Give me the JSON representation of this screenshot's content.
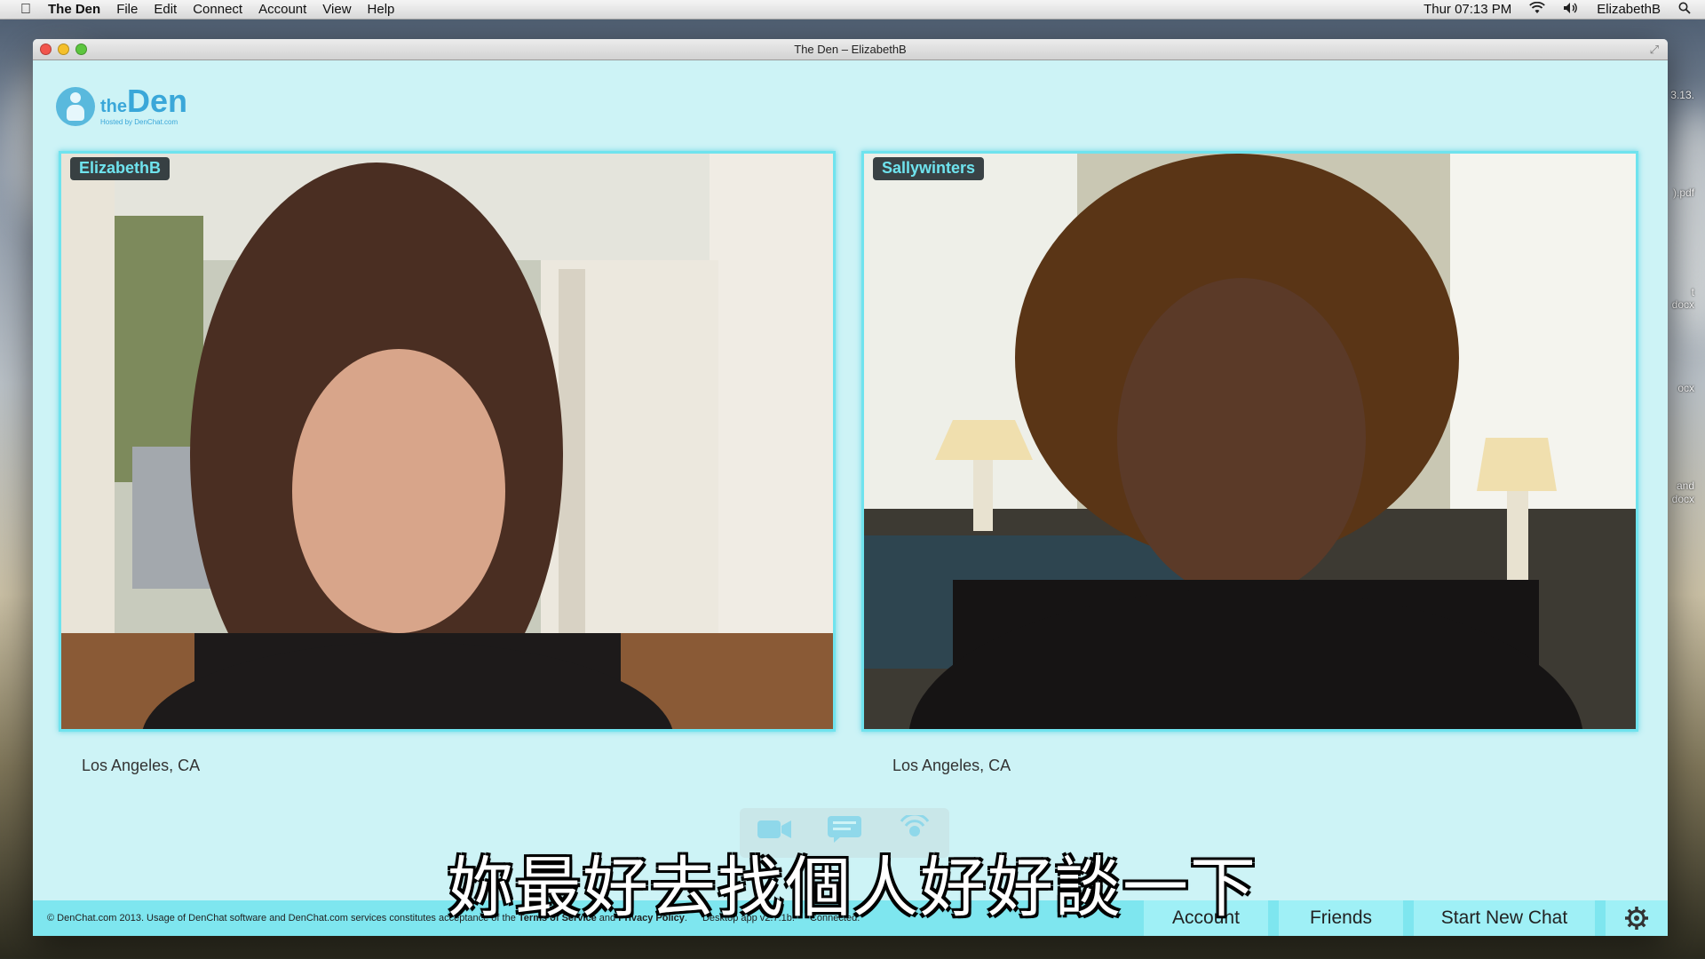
{
  "menubar": {
    "app_name": "The Den",
    "menus": [
      "File",
      "Edit",
      "Connect",
      "Account",
      "View",
      "Help"
    ],
    "clock": "Thur 07:13 PM",
    "user": "ElizabethB"
  },
  "desktop": {
    "edge_labels": [
      "3.13.",
      ").pdf",
      "t",
      "docx",
      "ocx",
      "and",
      "docx"
    ]
  },
  "window": {
    "title": "The Den – ElizabethB"
  },
  "logo": {
    "the": "the",
    "den": "Den",
    "tagline": "Hosted by DenChat.com"
  },
  "participants": [
    {
      "name": "ElizabethB",
      "location": "Los Angeles, CA"
    },
    {
      "name": "Sallywinters",
      "location": "Los Angeles, CA"
    }
  ],
  "toolbar": {
    "icons": [
      "video-camera-icon",
      "chat-icon",
      "audio-icon"
    ]
  },
  "subtitle": "妳最好去找個人好好談一下",
  "footer": {
    "copy_prefix": "© DenChat.com 2013. Usage of DenChat software and DenChat.com services constitutes acceptance of the",
    "terms": "Terms of Service",
    "and": "and",
    "privacy": "Privacy Policy",
    "period": ".",
    "version": "Desktop app v2.7.1b.",
    "status": "Connected.",
    "nav": {
      "account": "Account",
      "friends": "Friends",
      "start_new_chat": "Start New Chat"
    }
  },
  "colors": {
    "window_bg": "#cdf3f6",
    "accent": "#6fe3ee",
    "footer_bg": "#7ee6ef",
    "logo": "#3aa7d9"
  }
}
